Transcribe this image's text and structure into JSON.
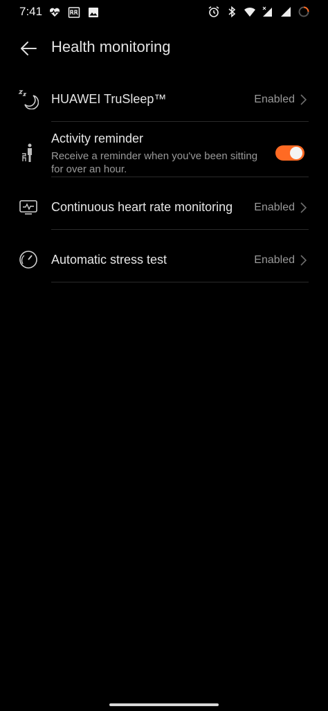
{
  "status_bar": {
    "time": "7:41",
    "icons_left": [
      "heart-rate-icon",
      "rr-icon",
      "image-icon"
    ],
    "icons_right": [
      "alarm-icon",
      "bluetooth-icon",
      "wifi-icon",
      "signal-icon",
      "signal-icon-2",
      "loading-ring-icon"
    ]
  },
  "header": {
    "title": "Health monitoring"
  },
  "settings": {
    "trusleep": {
      "label": "HUAWEI TruSleep™",
      "value": "Enabled"
    },
    "activity": {
      "label": "Activity reminder",
      "sublabel": "Receive a reminder when you've been sitting for over an hour.",
      "enabled": true
    },
    "heart_rate": {
      "label": "Continuous heart rate monitoring",
      "value": "Enabled"
    },
    "stress": {
      "label": "Automatic stress test",
      "value": "Enabled"
    }
  },
  "colors": {
    "accent": "#ff6a23",
    "background": "#000000"
  }
}
